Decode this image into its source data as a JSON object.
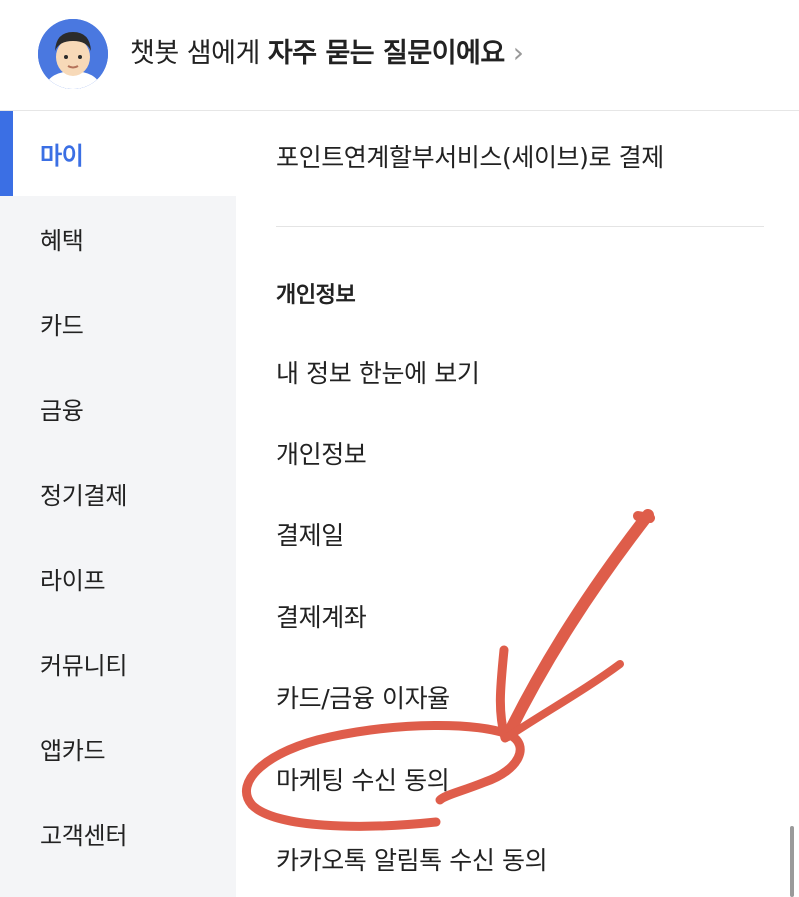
{
  "header": {
    "prefix": "챗봇 샘에게 ",
    "emphasis": "자주 묻는 질문이에요",
    "chevron": "›",
    "avatar_icon": "chatbot-character-avatar"
  },
  "sidebar": {
    "items": [
      {
        "label": "마이",
        "active": true
      },
      {
        "label": "혜택"
      },
      {
        "label": "카드"
      },
      {
        "label": "금융"
      },
      {
        "label": "정기결제"
      },
      {
        "label": "라이프"
      },
      {
        "label": "커뮤니티"
      },
      {
        "label": "앱카드"
      },
      {
        "label": "고객센터"
      }
    ]
  },
  "main": {
    "top_item": "포인트연계할부서비스(세이브)로 결제",
    "section_title": "개인정보",
    "items": [
      "내 정보 한눈에 보기",
      "개인정보",
      "결제일",
      "결제계좌",
      "카드/금융 이자율",
      "마케팅 수신 동의",
      "카카오톡 알림톡 수신 동의"
    ]
  },
  "colors": {
    "accent": "#3b6fe4",
    "annotation": "#d9412b"
  }
}
